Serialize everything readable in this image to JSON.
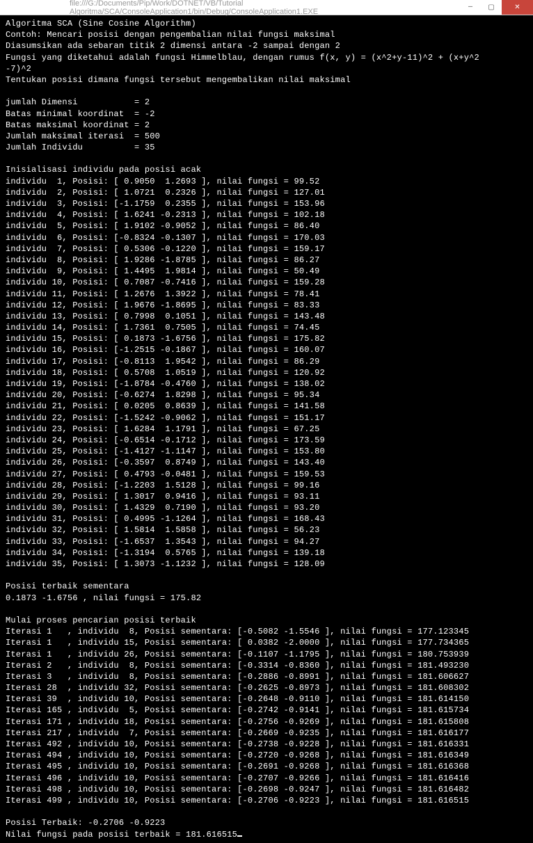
{
  "window": {
    "title": "file:///G:/Documents/Pip/Work/DOTNET/VB/Tutorial Algoritma/SCA/ConsoleApplication1/bin/Debug/ConsoleApplication1.EXE",
    "minimize": "—",
    "maximize": "▢",
    "close": "✕"
  },
  "header": [
    "Algoritma SCA (Sine Cosine Algorithm)",
    "Contoh: Mencari posisi dengan pengembalian nilai fungsi maksimal",
    "Diasumsikan ada sebaran titik 2 dimensi antara -2 sampai dengan 2",
    "Fungsi yang diketahui adalah fungsi Himmelblau, dengan rumus f(x, y) = (x^2+y-11)^2 + (x+y^2",
    "-7)^2",
    "Tentukan posisi dimana fungsi tersebut mengembalikan nilai maksimal",
    ""
  ],
  "params": [
    "jumlah Dimensi           = 2",
    "Batas minimal koordinat  = -2",
    "Batas maksimal koordinat = 2",
    "Jumlah maksimal iterasi  = 500",
    "Jumlah Individu          = 35",
    ""
  ],
  "init_title": "Inisialisasi individu pada posisi acak",
  "individuals": [
    {
      "i": 1,
      "x": "0.9050",
      "y": "1.2693",
      "f": "99.52"
    },
    {
      "i": 2,
      "x": "1.0721",
      "y": "0.2326",
      "f": "127.01"
    },
    {
      "i": 3,
      "x": "-1.1759",
      "y": "0.2355",
      "f": "153.96"
    },
    {
      "i": 4,
      "x": "1.6241",
      "y": "-0.2313",
      "f": "102.18"
    },
    {
      "i": 5,
      "x": "1.9102",
      "y": "-0.9052",
      "f": "86.40"
    },
    {
      "i": 6,
      "x": "-0.8324",
      "y": "-0.1307",
      "f": "170.03"
    },
    {
      "i": 7,
      "x": "0.5306",
      "y": "-0.1220",
      "f": "159.17"
    },
    {
      "i": 8,
      "x": "1.9286",
      "y": "-1.8785",
      "f": "86.27"
    },
    {
      "i": 9,
      "x": "1.4495",
      "y": "1.9814",
      "f": "50.49"
    },
    {
      "i": 10,
      "x": "0.7087",
      "y": "-0.7416",
      "f": "159.28"
    },
    {
      "i": 11,
      "x": "1.2676",
      "y": "1.3922",
      "f": "78.41"
    },
    {
      "i": 12,
      "x": "1.9676",
      "y": "-1.8695",
      "f": "83.33"
    },
    {
      "i": 13,
      "x": "0.7998",
      "y": "0.1051",
      "f": "143.48"
    },
    {
      "i": 14,
      "x": "1.7361",
      "y": "0.7505",
      "f": "74.45"
    },
    {
      "i": 15,
      "x": "0.1873",
      "y": "-1.6756",
      "f": "175.82"
    },
    {
      "i": 16,
      "x": "-1.2515",
      "y": "-0.1867",
      "f": "160.07"
    },
    {
      "i": 17,
      "x": "-0.8113",
      "y": "1.9542",
      "f": "86.29"
    },
    {
      "i": 18,
      "x": "0.5708",
      "y": "1.0519",
      "f": "120.92"
    },
    {
      "i": 19,
      "x": "-1.8784",
      "y": "-0.4760",
      "f": "138.02"
    },
    {
      "i": 20,
      "x": "-0.6274",
      "y": "1.8298",
      "f": "95.34"
    },
    {
      "i": 21,
      "x": "0.0205",
      "y": "0.8639",
      "f": "141.58"
    },
    {
      "i": 22,
      "x": "-1.5242",
      "y": "-0.9062",
      "f": "151.17"
    },
    {
      "i": 23,
      "x": "1.6284",
      "y": "1.1791",
      "f": "67.25"
    },
    {
      "i": 24,
      "x": "-0.6514",
      "y": "-0.1712",
      "f": "173.59"
    },
    {
      "i": 25,
      "x": "-1.4127",
      "y": "-1.1147",
      "f": "153.80"
    },
    {
      "i": 26,
      "x": "-0.3597",
      "y": "0.8749",
      "f": "143.40"
    },
    {
      "i": 27,
      "x": "0.4793",
      "y": "-0.0481",
      "f": "159.53"
    },
    {
      "i": 28,
      "x": "-1.2203",
      "y": "1.5128",
      "f": "99.16"
    },
    {
      "i": 29,
      "x": "1.3017",
      "y": "0.9416",
      "f": "93.11"
    },
    {
      "i": 30,
      "x": "1.4329",
      "y": "0.7190",
      "f": "93.20"
    },
    {
      "i": 31,
      "x": "0.4995",
      "y": "-1.1264",
      "f": "168.43"
    },
    {
      "i": 32,
      "x": "1.5814",
      "y": "1.5858",
      "f": "56.23"
    },
    {
      "i": 33,
      "x": "-1.6537",
      "y": "1.3543",
      "f": "94.27"
    },
    {
      "i": 34,
      "x": "-1.3194",
      "y": "0.5765",
      "f": "139.18"
    },
    {
      "i": 35,
      "x": "1.3073",
      "y": "-1.1232",
      "f": "128.09"
    }
  ],
  "best_title": "Posisi terbaik sementara",
  "best_line": "0.1873 -1.6756 , nilai fungsi = 175.82",
  "search_title": "Mulai proses pencarian posisi terbaik",
  "iterations": [
    {
      "it": 1,
      "ind": 8,
      "x": "-0.5082",
      "y": "-1.5546",
      "f": "177.123345"
    },
    {
      "it": 1,
      "ind": 15,
      "x": "0.0382",
      "y": "-2.0000",
      "f": "177.734365"
    },
    {
      "it": 1,
      "ind": 26,
      "x": "-0.1107",
      "y": "-1.1795",
      "f": "180.753939"
    },
    {
      "it": 2,
      "ind": 8,
      "x": "-0.3314",
      "y": "-0.8360",
      "f": "181.493230"
    },
    {
      "it": 3,
      "ind": 8,
      "x": "-0.2886",
      "y": "-0.8991",
      "f": "181.606627"
    },
    {
      "it": 28,
      "ind": 32,
      "x": "-0.2625",
      "y": "-0.8973",
      "f": "181.608302"
    },
    {
      "it": 39,
      "ind": 10,
      "x": "-0.2648",
      "y": "-0.9110",
      "f": "181.614150"
    },
    {
      "it": 165,
      "ind": 5,
      "x": "-0.2742",
      "y": "-0.9141",
      "f": "181.615734"
    },
    {
      "it": 171,
      "ind": 18,
      "x": "-0.2756",
      "y": "-0.9269",
      "f": "181.615808"
    },
    {
      "it": 217,
      "ind": 7,
      "x": "-0.2669",
      "y": "-0.9235",
      "f": "181.616177"
    },
    {
      "it": 492,
      "ind": 10,
      "x": "-0.2738",
      "y": "-0.9228",
      "f": "181.616331"
    },
    {
      "it": 494,
      "ind": 10,
      "x": "-0.2720",
      "y": "-0.9268",
      "f": "181.616349"
    },
    {
      "it": 495,
      "ind": 10,
      "x": "-0.2691",
      "y": "-0.9268",
      "f": "181.616368"
    },
    {
      "it": 496,
      "ind": 10,
      "x": "-0.2707",
      "y": "-0.9266",
      "f": "181.616416"
    },
    {
      "it": 498,
      "ind": 10,
      "x": "-0.2698",
      "y": "-0.9247",
      "f": "181.616482"
    },
    {
      "it": 499,
      "ind": 10,
      "x": "-0.2706",
      "y": "-0.9223",
      "f": "181.616515"
    }
  ],
  "final": [
    "",
    "Posisi Terbaik: -0.2706 -0.9223",
    "Nilai fungsi pada posisi terbaik = 181.616515"
  ]
}
